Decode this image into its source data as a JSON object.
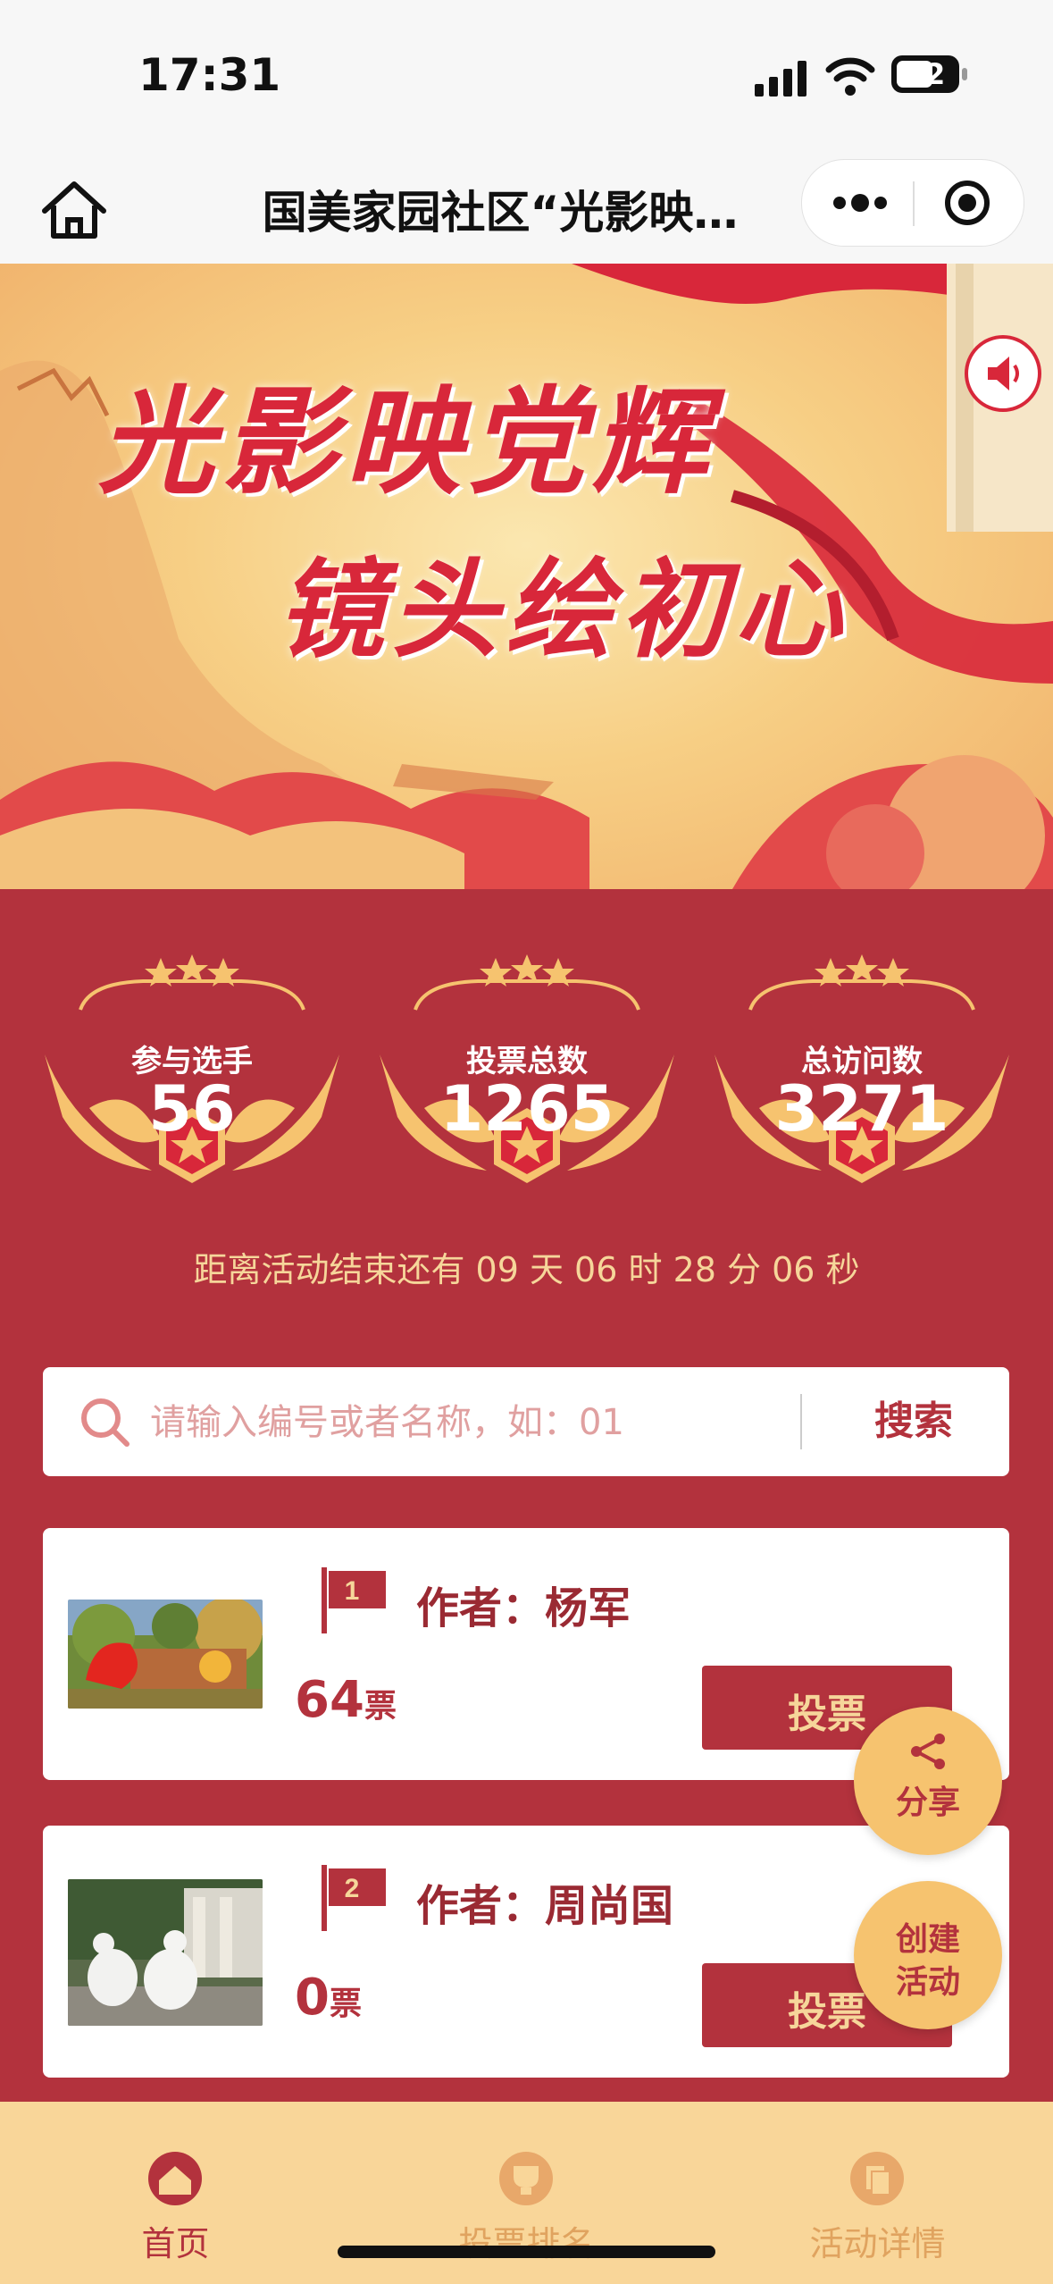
{
  "status_bar": {
    "time": "17:31",
    "battery": "52"
  },
  "nav": {
    "title": "国美家园社区“光影映…"
  },
  "banner": {
    "line1": "光影映党辉",
    "line2": "镜头绘初心"
  },
  "stats": [
    {
      "label": "参与选手",
      "value": "56"
    },
    {
      "label": "投票总数",
      "value": "1265"
    },
    {
      "label": "总访问数",
      "value": "3271"
    }
  ],
  "countdown": "距离活动结束还有 09 天 06 时 28 分 06 秒",
  "search": {
    "placeholder": "请输入编号或者名称，如：01",
    "button": "搜索"
  },
  "entries": [
    {
      "rank": "1",
      "author": "作者：杨军",
      "votes": "64",
      "vote_unit": "票",
      "button": "投票"
    },
    {
      "rank": "2",
      "author": "作者：周尚国",
      "votes": "0",
      "vote_unit": "票",
      "button": "投票"
    }
  ],
  "floating": {
    "share": "分享",
    "create_line1": "创建",
    "create_line2": "活动"
  },
  "tabs": [
    {
      "label": "首页",
      "icon": "home-icon",
      "active": true
    },
    {
      "label": "投票排名",
      "icon": "trophy-icon",
      "active": false
    },
    {
      "label": "活动详情",
      "icon": "document-icon",
      "active": false
    }
  ],
  "colors": {
    "primary": "#b3323d",
    "gold": "#f6c36f",
    "tabbar": "#f9d699",
    "active_tab": "#b3323d",
    "inactive_tab": "#e0a35f"
  }
}
